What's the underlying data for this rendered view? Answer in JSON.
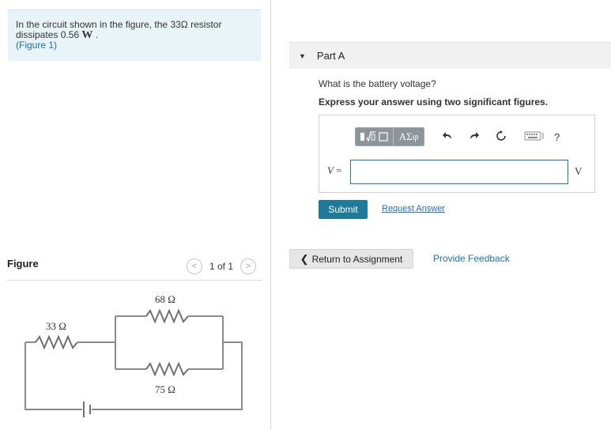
{
  "problem": {
    "text_before": "In the circuit shown in the figure, the 33",
    "omega": "Ω",
    "text_middle": " resistor",
    "text_line2": "dissipates 0.56 ",
    "unit_w": "W",
    "period": " .",
    "figure_link": "(Figure 1)"
  },
  "figure": {
    "title": "Figure",
    "pager_text": "1 of 1",
    "prev_glyph": "<",
    "next_glyph": ">",
    "labels": {
      "r1": "33 Ω",
      "r2": "68 Ω",
      "r3": "75 Ω"
    }
  },
  "part": {
    "label": "Part A",
    "question": "What is the battery voltage?",
    "instruction": "Express your answer using two significant figures."
  },
  "answer": {
    "symbols_label": "ΑΣφ",
    "variable": "V",
    "equals": " =",
    "value": "",
    "unit": "V",
    "help": "?"
  },
  "actions": {
    "submit": "Submit",
    "request": "Request Answer",
    "return": "Return to Assignment",
    "feedback": "Provide Feedback"
  },
  "colors": {
    "accent": "#1d7a9b",
    "link": "#1e6fb5",
    "problem_bg": "#e8f4f8"
  }
}
